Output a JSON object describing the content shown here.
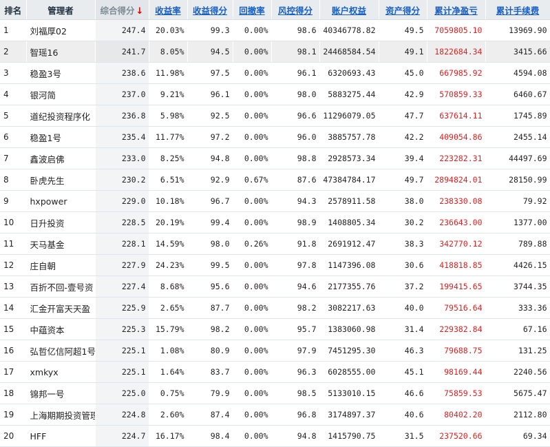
{
  "headers": [
    "排名",
    "管理者",
    "综合得分",
    "收益率",
    "收益得分",
    "回撤率",
    "风控得分",
    "账户权益",
    "资产得分",
    "累计净盈亏",
    "累计手续费"
  ],
  "sort_arrow": "↓",
  "accent_red": "#e02020",
  "link_blue": "#1a5fc2",
  "rows": [
    [
      "1",
      "刘福厚02",
      "247.4",
      "20.03%",
      "99.3",
      "0.00%",
      "98.6",
      "40346778.82",
      "49.5",
      "7059805.10",
      "13969.90"
    ],
    [
      "2",
      "智瑶16",
      "241.7",
      "8.05%",
      "94.5",
      "0.00%",
      "98.1",
      "24468584.54",
      "49.1",
      "1822684.34",
      "3415.66"
    ],
    [
      "3",
      "稳盈3号",
      "238.6",
      "11.98%",
      "97.5",
      "0.00%",
      "96.1",
      "6320693.43",
      "45.0",
      "667985.92",
      "4594.08"
    ],
    [
      "4",
      "银河简",
      "237.0",
      "9.21%",
      "96.1",
      "0.00%",
      "98.0",
      "5883275.44",
      "42.9",
      "570859.33",
      "6460.67"
    ],
    [
      "5",
      "道纪投资程序化",
      "236.8",
      "5.98%",
      "92.5",
      "0.00%",
      "96.6",
      "11296079.05",
      "47.7",
      "637614.11",
      "1745.89"
    ],
    [
      "6",
      "稳盈1号",
      "235.4",
      "11.77%",
      "97.2",
      "0.00%",
      "96.0",
      "3885757.78",
      "42.2",
      "409054.86",
      "2455.14"
    ],
    [
      "7",
      "鑫波启佛",
      "233.0",
      "8.25%",
      "94.8",
      "0.00%",
      "98.8",
      "2928573.34",
      "39.4",
      "223282.31",
      "44497.69"
    ],
    [
      "8",
      "卧虎先生",
      "230.2",
      "6.51%",
      "92.9",
      "0.67%",
      "87.6",
      "47384784.17",
      "49.7",
      "2894824.01",
      "28150.99"
    ],
    [
      "9",
      "hxpower",
      "229.0",
      "10.18%",
      "96.7",
      "0.00%",
      "94.3",
      "2578911.58",
      "38.0",
      "238330.08",
      "79.92"
    ],
    [
      "10",
      "日升投资",
      "228.5",
      "20.19%",
      "99.4",
      "0.00%",
      "98.9",
      "1408805.34",
      "30.2",
      "236643.00",
      "1377.00"
    ],
    [
      "11",
      "天马基金",
      "228.1",
      "14.59%",
      "98.0",
      "0.26%",
      "91.8",
      "2691912.47",
      "38.3",
      "342770.12",
      "789.88"
    ],
    [
      "12",
      "庄自朝",
      "227.9",
      "24.23%",
      "99.5",
      "0.00%",
      "97.8",
      "1147396.08",
      "30.6",
      "418818.85",
      "4426.15"
    ],
    [
      "13",
      "百折不回-壹号资",
      "227.4",
      "8.68%",
      "95.6",
      "0.00%",
      "94.6",
      "2177355.76",
      "37.2",
      "199415.65",
      "3744.35"
    ],
    [
      "14",
      "汇金开富天天盈",
      "225.9",
      "2.65%",
      "87.7",
      "0.00%",
      "98.2",
      "3082217.63",
      "40.0",
      "79516.64",
      "333.36"
    ],
    [
      "15",
      "中蕴资本",
      "225.3",
      "15.79%",
      "98.2",
      "0.00%",
      "95.7",
      "1383060.98",
      "31.4",
      "229382.84",
      "67.16"
    ],
    [
      "16",
      "弘哲亿信阿超1号",
      "225.1",
      "1.08%",
      "80.9",
      "0.00%",
      "97.9",
      "7451295.30",
      "46.3",
      "79688.75",
      "131.25"
    ],
    [
      "17",
      "xmkyx",
      "225.1",
      "1.64%",
      "83.7",
      "0.00%",
      "96.3",
      "6028555.00",
      "45.1",
      "98169.44",
      "2240.56"
    ],
    [
      "18",
      "锦邦一号",
      "225.0",
      "0.75%",
      "79.9",
      "0.00%",
      "98.5",
      "5133010.15",
      "46.6",
      "75859.53",
      "5675.47"
    ],
    [
      "19",
      "上海期期投资管理",
      "224.8",
      "2.60%",
      "87.4",
      "0.00%",
      "96.8",
      "3174897.37",
      "40.6",
      "80402.20",
      "2112.80"
    ],
    [
      "20",
      "HFF",
      "224.7",
      "16.17%",
      "98.4",
      "0.00%",
      "94.8",
      "1415790.75",
      "31.5",
      "237520.66",
      "69.34"
    ]
  ]
}
